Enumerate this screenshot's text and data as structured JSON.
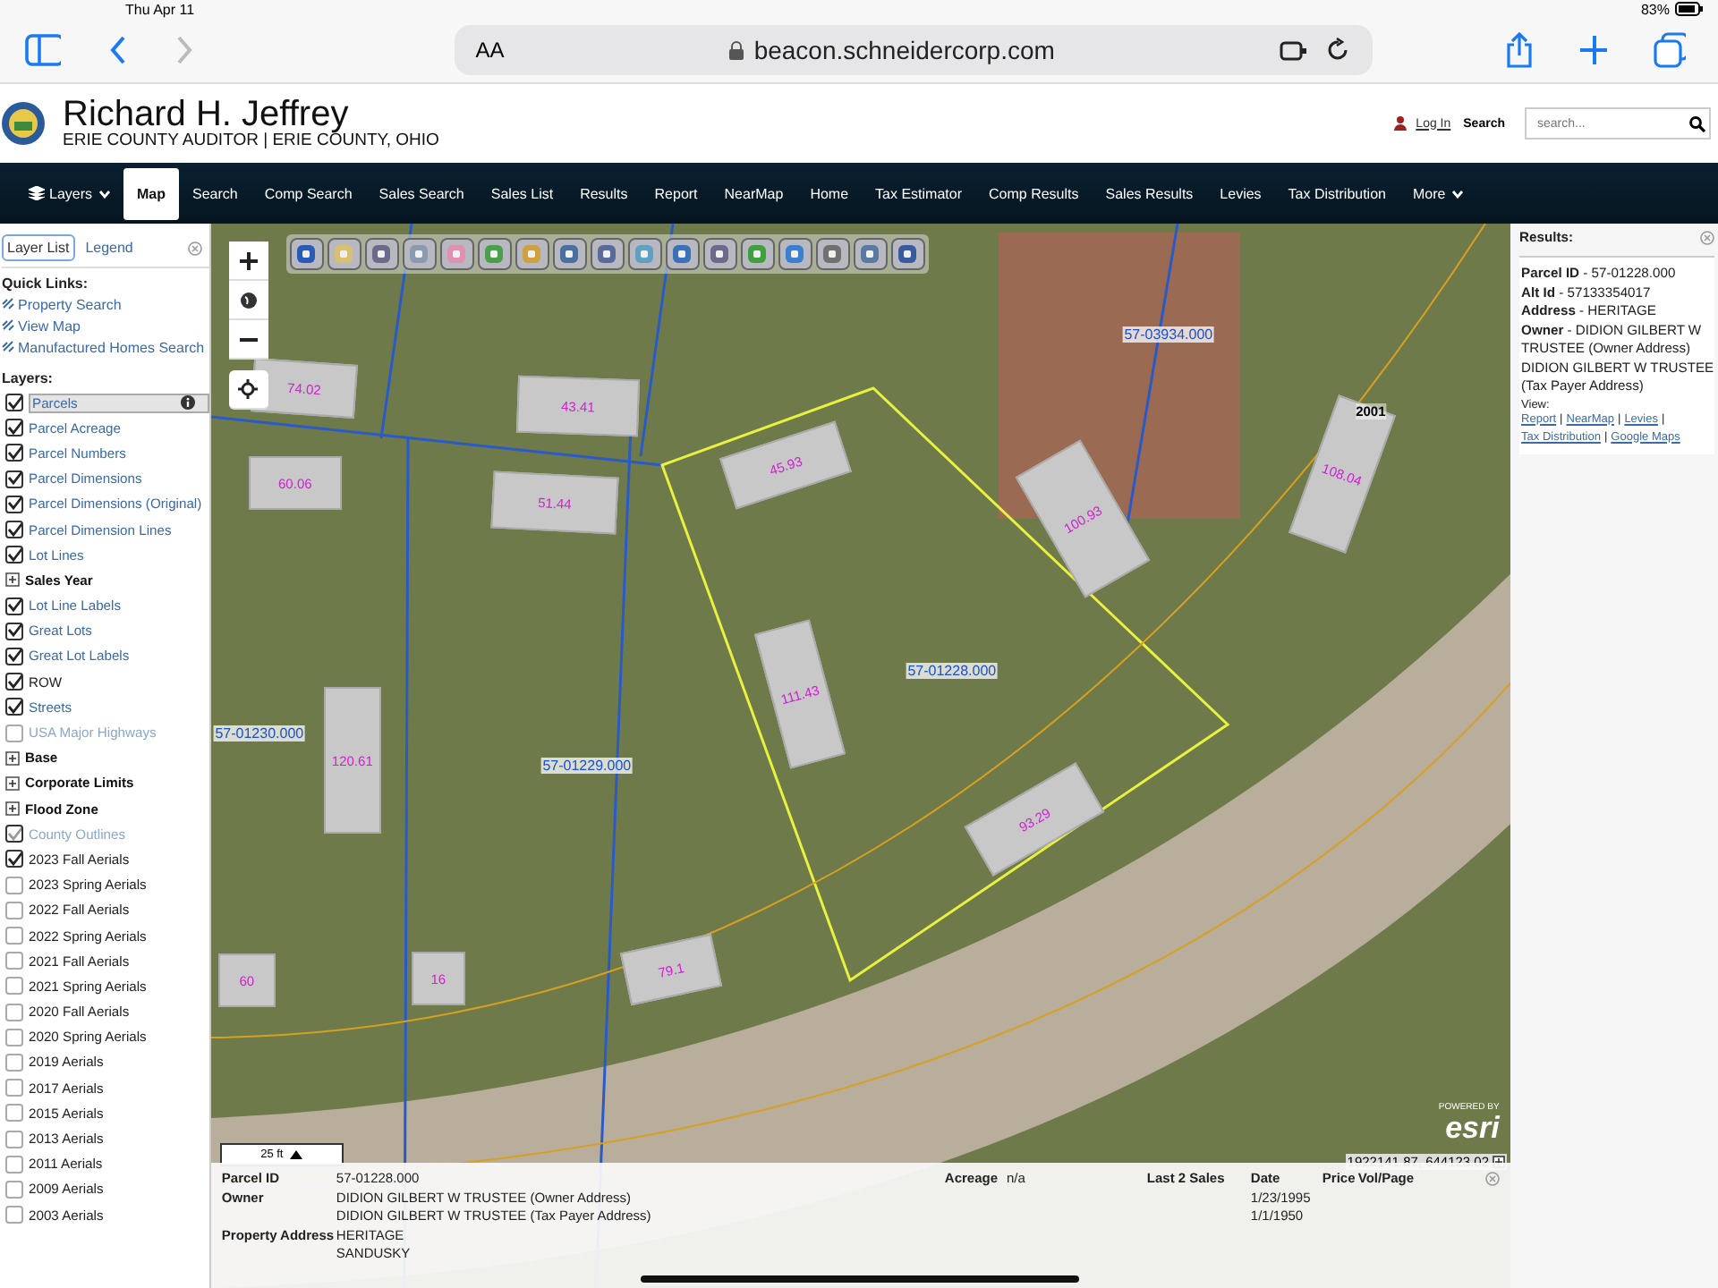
{
  "browser": {
    "date": "Thu Apr 11",
    "battery": "83%",
    "text_size": "AA",
    "address": "beacon.schneidercorp.com"
  },
  "header": {
    "title": "Richard H. Jeffrey",
    "subtitle": "ERIE COUNTY AUDITOR | ERIE COUNTY, OHIO",
    "login": "Log In",
    "search_label": "Search",
    "search_placeholder": "search..."
  },
  "nav": [
    {
      "label": "Layers",
      "kind": "dropdown",
      "selected": false
    },
    {
      "label": "Map",
      "kind": "link",
      "selected": true
    },
    {
      "label": "Search",
      "kind": "link",
      "selected": false
    },
    {
      "label": "Comp Search",
      "kind": "link",
      "selected": false
    },
    {
      "label": "Sales Search",
      "kind": "link",
      "selected": false
    },
    {
      "label": "Sales List",
      "kind": "link",
      "selected": false
    },
    {
      "label": "Results",
      "kind": "link",
      "selected": false
    },
    {
      "label": "Report",
      "kind": "link",
      "selected": false
    },
    {
      "label": "NearMap",
      "kind": "link",
      "selected": false
    },
    {
      "label": "Home",
      "kind": "link",
      "selected": false
    },
    {
      "label": "Tax Estimator",
      "kind": "link",
      "selected": false
    },
    {
      "label": "Comp Results",
      "kind": "link",
      "selected": false
    },
    {
      "label": "Sales Results",
      "kind": "link",
      "selected": false
    },
    {
      "label": "Levies",
      "kind": "link",
      "selected": false
    },
    {
      "label": "Tax Distribution",
      "kind": "link",
      "selected": false
    },
    {
      "label": "More",
      "kind": "dropdown",
      "selected": false
    }
  ],
  "panel": {
    "tabs": [
      {
        "label": "Layer List",
        "selected": true
      },
      {
        "label": "Legend",
        "selected": false
      }
    ],
    "quick_links_heading": "Quick Links:",
    "quick_links": [
      "Property Search",
      "View Map",
      "Manufactured Homes Search"
    ],
    "layers_heading": "Layers:",
    "layers": [
      {
        "label": "Parcels",
        "kind": "layer",
        "checked": true,
        "disabled": false,
        "selected": true
      },
      {
        "label": "Parcel Acreage",
        "kind": "layer",
        "checked": true,
        "disabled": false,
        "selected": false
      },
      {
        "label": "Parcel Numbers",
        "kind": "layer",
        "checked": true,
        "disabled": false,
        "selected": false
      },
      {
        "label": "Parcel Dimensions",
        "kind": "layer",
        "checked": true,
        "disabled": false,
        "selected": false
      },
      {
        "label": "Parcel Dimensions (Original)",
        "kind": "layer",
        "checked": true,
        "disabled": false,
        "selected": false
      },
      {
        "label": "Parcel Dimension Lines",
        "kind": "layer",
        "checked": true,
        "disabled": false,
        "selected": false
      },
      {
        "label": "Lot Lines",
        "kind": "layer",
        "checked": true,
        "disabled": false,
        "selected": false
      },
      {
        "label": "Sales Year",
        "kind": "group",
        "disabled": false,
        "selected": false
      },
      {
        "label": "Lot Line Labels",
        "kind": "layer",
        "checked": true,
        "disabled": false,
        "selected": false
      },
      {
        "label": "Great Lots",
        "kind": "layer",
        "checked": true,
        "disabled": false,
        "selected": false
      },
      {
        "label": "Great Lot Labels",
        "kind": "layer",
        "checked": true,
        "disabled": false,
        "selected": false
      },
      {
        "label": "ROW",
        "kind": "aerial",
        "checked": true,
        "disabled": false,
        "selected": false
      },
      {
        "label": "Streets",
        "kind": "layer",
        "checked": true,
        "disabled": false,
        "selected": false
      },
      {
        "label": "USA Major Highways",
        "kind": "layer",
        "checked": false,
        "disabled": true,
        "selected": false
      },
      {
        "label": "Base",
        "kind": "group",
        "disabled": false,
        "selected": false
      },
      {
        "label": "Corporate Limits",
        "kind": "group",
        "disabled": false,
        "selected": false
      },
      {
        "label": "Flood Zone",
        "kind": "group",
        "disabled": false,
        "selected": false
      },
      {
        "label": "County Outlines",
        "kind": "layer",
        "checked": true,
        "disabled": true,
        "selected": false
      },
      {
        "label": "2023 Fall Aerials",
        "kind": "aerial",
        "checked": true,
        "disabled": false,
        "selected": false
      },
      {
        "label": "2023 Spring Aerials",
        "kind": "aerial",
        "checked": false,
        "disabled": false,
        "selected": false
      },
      {
        "label": "2022 Fall Aerials",
        "kind": "aerial",
        "checked": false,
        "disabled": false,
        "selected": false
      },
      {
        "label": "2022 Spring Aerials",
        "kind": "aerial",
        "checked": false,
        "disabled": false,
        "selected": false
      },
      {
        "label": "2021 Fall Aerials",
        "kind": "aerial",
        "checked": false,
        "disabled": false,
        "selected": false
      },
      {
        "label": "2021 Spring Aerials",
        "kind": "aerial",
        "checked": false,
        "disabled": false,
        "selected": false
      },
      {
        "label": "2020 Fall Aerials",
        "kind": "aerial",
        "checked": false,
        "disabled": false,
        "selected": false
      },
      {
        "label": "2020 Spring Aerials",
        "kind": "aerial",
        "checked": false,
        "disabled": false,
        "selected": false
      },
      {
        "label": "2019 Aerials",
        "kind": "aerial",
        "checked": false,
        "disabled": false,
        "selected": false
      },
      {
        "label": "2017 Aerials",
        "kind": "aerial",
        "checked": false,
        "disabled": false,
        "selected": false
      },
      {
        "label": "2015 Aerials",
        "kind": "aerial",
        "checked": false,
        "disabled": false,
        "selected": false
      },
      {
        "label": "2013 Aerials",
        "kind": "aerial",
        "checked": false,
        "disabled": false,
        "selected": false
      },
      {
        "label": "2011 Aerials",
        "kind": "aerial",
        "checked": false,
        "disabled": false,
        "selected": false
      },
      {
        "label": "2009 Aerials",
        "kind": "aerial",
        "checked": false,
        "disabled": false,
        "selected": false
      },
      {
        "label": "2003 Aerials",
        "kind": "aerial",
        "checked": false,
        "disabled": false,
        "selected": false
      }
    ]
  },
  "map": {
    "labels": [
      {
        "text": "74.02",
        "kind": "dimension"
      },
      {
        "text": "43.41",
        "kind": "dimension"
      },
      {
        "text": "60.06",
        "kind": "dimension"
      },
      {
        "text": "51.44",
        "kind": "dimension"
      },
      {
        "text": "45.93",
        "kind": "dimension"
      },
      {
        "text": "100.93",
        "kind": "dimension"
      },
      {
        "text": "108.04",
        "kind": "dimension"
      },
      {
        "text": "111.43",
        "kind": "dimension"
      },
      {
        "text": "120.61",
        "kind": "dimension"
      },
      {
        "text": "93.29",
        "kind": "dimension"
      },
      {
        "text": "60",
        "kind": "dimension"
      },
      {
        "text": "16",
        "kind": "dimension"
      },
      {
        "text": "79.1",
        "kind": "dimension"
      },
      {
        "text": "57-03934.000",
        "kind": "parcel_id"
      },
      {
        "text": "57-01228.000",
        "kind": "parcel_id"
      },
      {
        "text": "57-01230.000",
        "kind": "parcel_id"
      },
      {
        "text": "57-01229.000",
        "kind": "parcel_id"
      },
      {
        "text": "2001",
        "kind": "address"
      }
    ],
    "scale": "25 ft",
    "coordinates": "1922141.87, 644123.02",
    "powered_by": "POWERED BY",
    "attribution": "esri"
  },
  "results": {
    "heading": "Results:",
    "lines": [
      "**Parcel ID** - 57-01228.000",
      "**Alt Id** - 57133354017",
      "**Address** - HERITAGE",
      "**Owner** - DIDION GILBERT W TRUSTEE (Owner Address) DIDION GILBERT W TRUSTEE (Tax Payer Address)"
    ],
    "view_label": "View:",
    "links": [
      "Report",
      "NearMap",
      "Levies",
      "Tax Distribution",
      "Google Maps"
    ],
    "link_separator": "|"
  },
  "info": {
    "parcel_id_label": "Parcel ID",
    "parcel_id": "57-01228.000",
    "owner_label": "Owner",
    "owners": [
      "DIDION GILBERT W TRUSTEE (Owner Address)",
      "DIDION GILBERT W TRUSTEE (Tax Payer Address)"
    ],
    "address_label": "Property Address",
    "address": [
      "HERITAGE",
      "SANDUSKY"
    ],
    "acreage_label": "Acreage",
    "acreage": "n/a",
    "sales_label": "Last 2 Sales",
    "date_label": "Date",
    "dates": [
      "1/23/1995",
      "1/1/1950"
    ],
    "price_label": "Price",
    "volpage_label": "Vol/Page"
  }
}
